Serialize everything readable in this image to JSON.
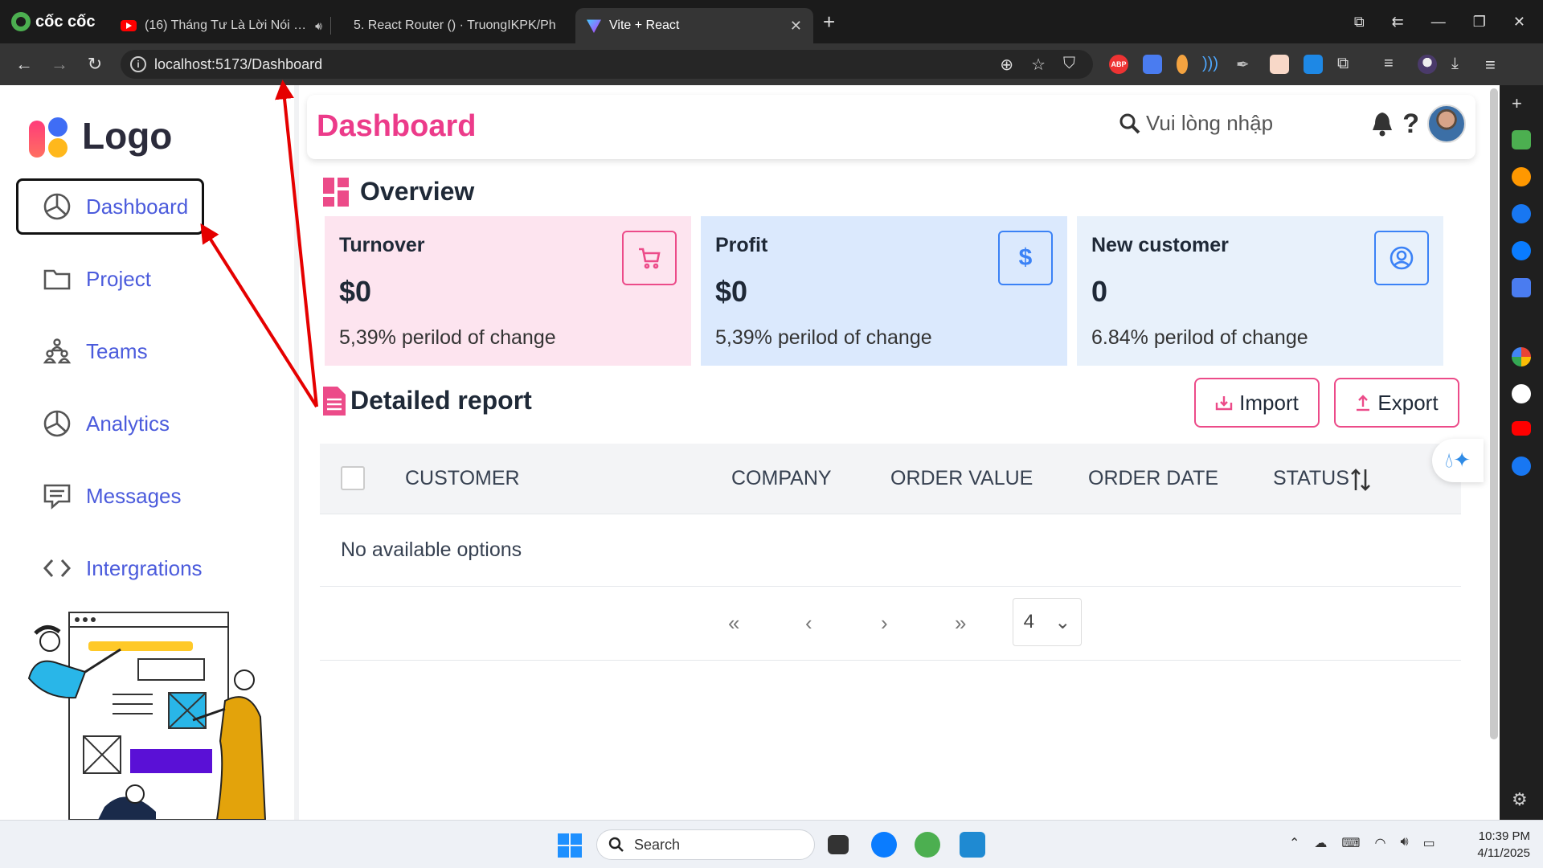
{
  "browser": {
    "brand": "cốc cốc",
    "tabs": [
      {
        "title": "(16) Tháng Tư Là Lời Nói Dối C",
        "active": false
      },
      {
        "title": "5. React Router () · TruongIKPK/Ph",
        "active": false
      },
      {
        "title": "Vite + React",
        "active": true
      }
    ],
    "url": "localhost:5173/Dashboard",
    "extensions": [
      "abp",
      "translate",
      "firefox",
      "waves",
      "pen",
      "dict",
      "drop",
      "puzzle"
    ]
  },
  "sidebar": {
    "logo": "Logo",
    "items": [
      {
        "label": "Dashboard",
        "icon": "pie-chart-icon",
        "active": true
      },
      {
        "label": "Project",
        "icon": "folder-icon",
        "active": false
      },
      {
        "label": "Teams",
        "icon": "team-icon",
        "active": false
      },
      {
        "label": "Analytics",
        "icon": "pie-chart-icon",
        "active": false
      },
      {
        "label": "Messages",
        "icon": "message-icon",
        "active": false
      },
      {
        "label": "Intergrations",
        "icon": "code-icon",
        "active": false
      }
    ]
  },
  "header": {
    "title": "Dashboard",
    "search_placeholder": "Vui lòng nhập",
    "help": "?"
  },
  "overview": {
    "title": "Overview",
    "cards": [
      {
        "title": "Turnover",
        "value": "$0",
        "change": "5,39% perilod of change",
        "icon": "cart-icon",
        "color": "#fde4ef"
      },
      {
        "title": "Profit",
        "value": "$0",
        "change": "5,39% perilod of change",
        "icon": "dollar-icon",
        "color": "#dbe9fd"
      },
      {
        "title": "New customer",
        "value": "0",
        "change": "6.84% perilod of change",
        "icon": "user-circle-icon",
        "color": "#e8f1fb"
      }
    ]
  },
  "report": {
    "title": "Detailed report",
    "import_label": "Import",
    "export_label": "Export",
    "columns": [
      "CUSTOMER",
      "COMPANY",
      "ORDER VALUE",
      "ORDER DATE",
      "STATUS"
    ],
    "empty_text": "No available options",
    "page_size": "4"
  },
  "taskbar": {
    "search": "Search",
    "time": "10:39 PM",
    "date": "4/11/2025"
  },
  "colors": {
    "accent_pink": "#ec3b8a",
    "menu_blue": "#4b5bdc",
    "annotation_red": "#e50000"
  }
}
